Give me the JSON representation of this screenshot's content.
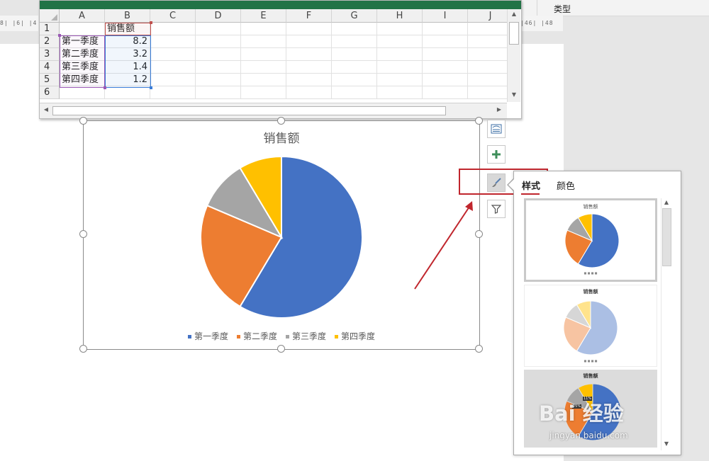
{
  "ribbon": {
    "type_label": "类型"
  },
  "ruler": {
    "left_text": "8| |6| |4",
    "right_text": "|46| |48"
  },
  "spreadsheet": {
    "columns": [
      "A",
      "B",
      "C",
      "D",
      "E",
      "F",
      "G",
      "H",
      "I",
      "J"
    ],
    "rows": [
      "1",
      "2",
      "3",
      "4",
      "5",
      "6"
    ],
    "cells": {
      "B1": "销售额",
      "A2": "第一季度",
      "B2": "8.2",
      "A3": "第二季度",
      "B3": "3.2",
      "A4": "第三季度",
      "B4": "1.4",
      "A5": "第四季度",
      "B5": "1.2"
    }
  },
  "chart": {
    "title": "销售额",
    "legend": [
      "第一季度",
      "第二季度",
      "第三季度",
      "第四季度"
    ]
  },
  "chart_data": {
    "type": "pie",
    "title": "销售额",
    "categories": [
      "第一季度",
      "第二季度",
      "第三季度",
      "第四季度"
    ],
    "values": [
      8.2,
      3.2,
      1.4,
      1.2
    ],
    "colors": [
      "#4472C4",
      "#ED7D31",
      "#A5A5A5",
      "#FFC000"
    ],
    "legend_position": "bottom"
  },
  "side_buttons": [
    {
      "name": "chart-layout-icon"
    },
    {
      "name": "chart-elements-plus-icon"
    },
    {
      "name": "chart-styles-brush-icon"
    },
    {
      "name": "chart-filter-icon"
    }
  ],
  "style_panel": {
    "tabs": [
      "样式",
      "颜色"
    ],
    "active_tab": "样式",
    "thumb_titles": [
      "销售额",
      "销售额",
      "销售额"
    ],
    "thumb_labels": [
      "25%",
      "11%"
    ]
  },
  "watermark": {
    "main": "Bai 经验",
    "sub": "jingyan.baidu.com"
  },
  "colors": {
    "excel_green": "#217346",
    "highlight_red": "#C0262D",
    "accent_blue": "#4472C4"
  }
}
